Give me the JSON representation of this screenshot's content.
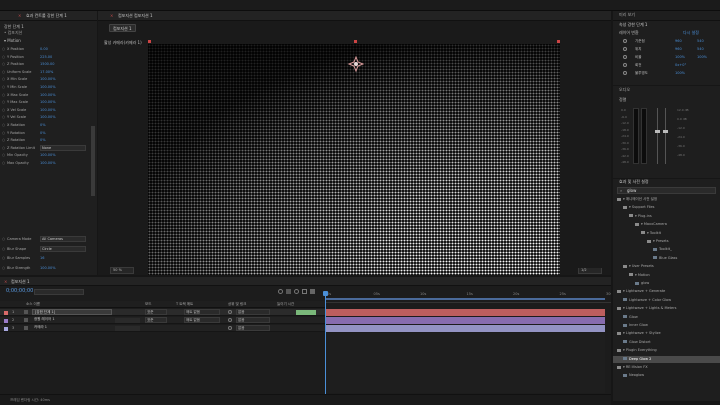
{
  "top_bar": {
    "close_marker": "×"
  },
  "effect_controls": {
    "tab_label": "효과 컨트롤 강한 단계 1",
    "header_line1": "강한 단계 1",
    "header_line2": "• 컴포지션",
    "section": "▾ Motion",
    "params": [
      {
        "label": "X Position",
        "value": "0.00"
      },
      {
        "label": "Y Position",
        "value": "225.00"
      },
      {
        "label": "Z Position",
        "value": "1500.00"
      },
      {
        "label": "Uniform Scale",
        "value": "17.00%"
      },
      {
        "label": "X Min Scale",
        "value": "100.00%"
      },
      {
        "label": "Y Min Scale",
        "value": "100.00%"
      },
      {
        "label": "X Max Scale",
        "value": "100.00%"
      },
      {
        "label": "Y Max Scale",
        "value": "100.00%"
      },
      {
        "label": "X Vel Scale",
        "value": "100.00%"
      },
      {
        "label": "Y Vel Scale",
        "value": "100.00%"
      },
      {
        "label": "X Rotation",
        "value": "0%"
      },
      {
        "label": "Y Rotation",
        "value": "0%"
      },
      {
        "label": "Z Rotation",
        "value": "0%"
      },
      {
        "label": "Z Rotation Limit",
        "value": "None"
      },
      {
        "label": "Min Opacity",
        "value": "100.00%"
      },
      {
        "label": "Max Opacity",
        "value": "100.00%"
      }
    ],
    "lower": [
      {
        "label": "Camera Mode",
        "value": "All Cameras"
      },
      {
        "label": "Blur Shape",
        "value": "Circle"
      },
      {
        "label": "Blur Samples",
        "value": "16"
      },
      {
        "label": "Blur Strength",
        "value": "100.00%"
      }
    ]
  },
  "composition": {
    "tab_label": "컴포지션 컴포지션 1",
    "sub_tab": "컴포지션 1",
    "camera_label": "활성 카메라(카메라 1)",
    "zoom": "50 %",
    "resolution": "1/2",
    "timecode": "0;00;00;00"
  },
  "info_panel": {
    "title": "미리 보기",
    "tab": "속성 강한 단계 1",
    "subhead": "레이어 변환",
    "reset": "다시 설정",
    "props": [
      {
        "label": "기준점",
        "v1": "960",
        "v2": "540"
      },
      {
        "label": "위치",
        "v1": "960",
        "v2": "540"
      },
      {
        "label": "비율",
        "v1": "100%",
        "v2": "100%"
      },
      {
        "label": "회전",
        "v1": "0x+0°",
        "v2": ""
      },
      {
        "label": "불투명도",
        "v1": "100%",
        "v2": ""
      }
    ],
    "audio_title": "오디오",
    "audio_label": "정렬",
    "audio_ticks": [
      "0.0",
      "-6.0",
      "-12.0",
      "-18.0",
      "-24.0",
      "-30.0",
      "-36.0",
      "-42.0",
      "-48.0"
    ],
    "audio_db": [
      "12.0 dB",
      "0.0 dB",
      "-12.0",
      "-24.0",
      "-36.0",
      "-48.0"
    ]
  },
  "effects_presets": {
    "title": "효과 및 사전 설정",
    "search_value": "glow",
    "tree": [
      {
        "depth": 0,
        "label": "▾ 애니메이션 사전 설정"
      },
      {
        "depth": 1,
        "label": "▾ Support Files"
      },
      {
        "depth": 2,
        "label": "▾ Plug-ins"
      },
      {
        "depth": 3,
        "label": "▾ MaxxCamera"
      },
      {
        "depth": 4,
        "label": "▾ Toolkit"
      },
      {
        "depth": 5,
        "label": "▾ Presets"
      },
      {
        "depth": 6,
        "label": "Toolkit_"
      },
      {
        "depth": 6,
        "label": "Blue Glass"
      },
      {
        "depth": 1,
        "label": "▾ User Presets"
      },
      {
        "depth": 2,
        "label": "▾ Motion"
      },
      {
        "depth": 3,
        "label": "glow"
      },
      {
        "depth": 0,
        "label": "▾ Lightwave + Generate"
      },
      {
        "depth": 1,
        "label": "Lightwave + Color Glow"
      },
      {
        "depth": 0,
        "label": "▾ Lightwave + Lights & Meters"
      },
      {
        "depth": 1,
        "label": "Glow"
      },
      {
        "depth": 1,
        "label": "Inner Glow"
      },
      {
        "depth": 0,
        "label": "▾ Lightwave + Stylize"
      },
      {
        "depth": 1,
        "label": "Glow Distort"
      },
      {
        "depth": 0,
        "label": "▾ Plugin Everything"
      },
      {
        "depth": 1,
        "label": "Deep Glow 2"
      },
      {
        "depth": 0,
        "label": "▾ RE:Vision FX"
      },
      {
        "depth": 1,
        "label": "Neoglow"
      }
    ],
    "selected_index": 19
  },
  "timeline": {
    "tab_label": "컴포지션 1",
    "timecode": "0;00;00;00",
    "col_source": "소스 이름",
    "col_mode": "모드",
    "col_trkmat": "T  트랙 매트",
    "col_parent": "상위 및 링크",
    "col_stretch": "늘이기 시간",
    "layers": [
      {
        "num": "1",
        "name": "[강한 단계 1]",
        "color": "#d96a6a",
        "mode": "표준",
        "mat": "매트 없음",
        "parent": "없음"
      },
      {
        "num": "2",
        "name": "광원 레이어 1",
        "color": "#9a7ac8",
        "mode": "표준",
        "mat": "매트 없음",
        "parent": "없음"
      },
      {
        "num": "3",
        "name": "카메라 1",
        "color": "#a8a8e0",
        "mode": "",
        "mat": "",
        "parent": "없음"
      }
    ],
    "ruler": [
      "0s",
      "05s",
      "10s",
      "15s",
      "20s",
      "25s",
      "30s"
    ],
    "footer": "프레임 렌더링 시간: 40ms"
  }
}
